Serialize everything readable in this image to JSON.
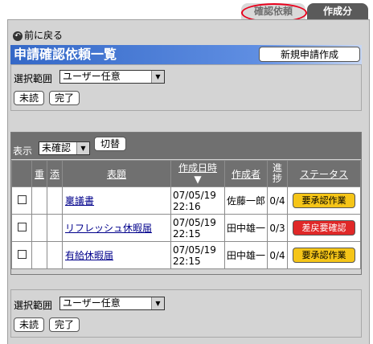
{
  "tabs": {
    "active": "確認依頼",
    "inactive": "作成分"
  },
  "back_label": "前に戻る",
  "page_title": "申請確認依頼一覧",
  "new_button": "新規申請作成",
  "filter": {
    "range_label": "選択範囲",
    "range_value": "ユーザー任意",
    "unread_btn": "未読",
    "done_btn": "完了"
  },
  "display": {
    "label": "表示",
    "value": "未確認",
    "switch_btn": "切替"
  },
  "columns": {
    "heavy": "重",
    "attach": "添",
    "subject": "表題",
    "created": "作成日時",
    "created_sort": "▼",
    "author": "作成者",
    "progress": "進捗",
    "status": "ステータス"
  },
  "rows": [
    {
      "subject": "稟議書",
      "date": "07/05/19",
      "time": "22:16",
      "author": "佐藤一郎",
      "progress": "0/4",
      "status": "要承認作業",
      "status_color": "#f5c518"
    },
    {
      "subject": "リフレッシュ休暇届",
      "date": "07/05/19",
      "time": "22:15",
      "author": "田中雄一",
      "progress": "0/3",
      "status": "差戻要確認",
      "status_color": "#e02828"
    },
    {
      "subject": "有給休暇届",
      "date": "07/05/19",
      "time": "22:15",
      "author": "田中雄一",
      "progress": "0/4",
      "status": "要承認作業",
      "status_color": "#f5c518"
    }
  ],
  "bottom_filter": {
    "range_label": "選択範囲",
    "range_value": "ユーザー任意",
    "unread_btn": "未読",
    "done_btn": "完了"
  }
}
